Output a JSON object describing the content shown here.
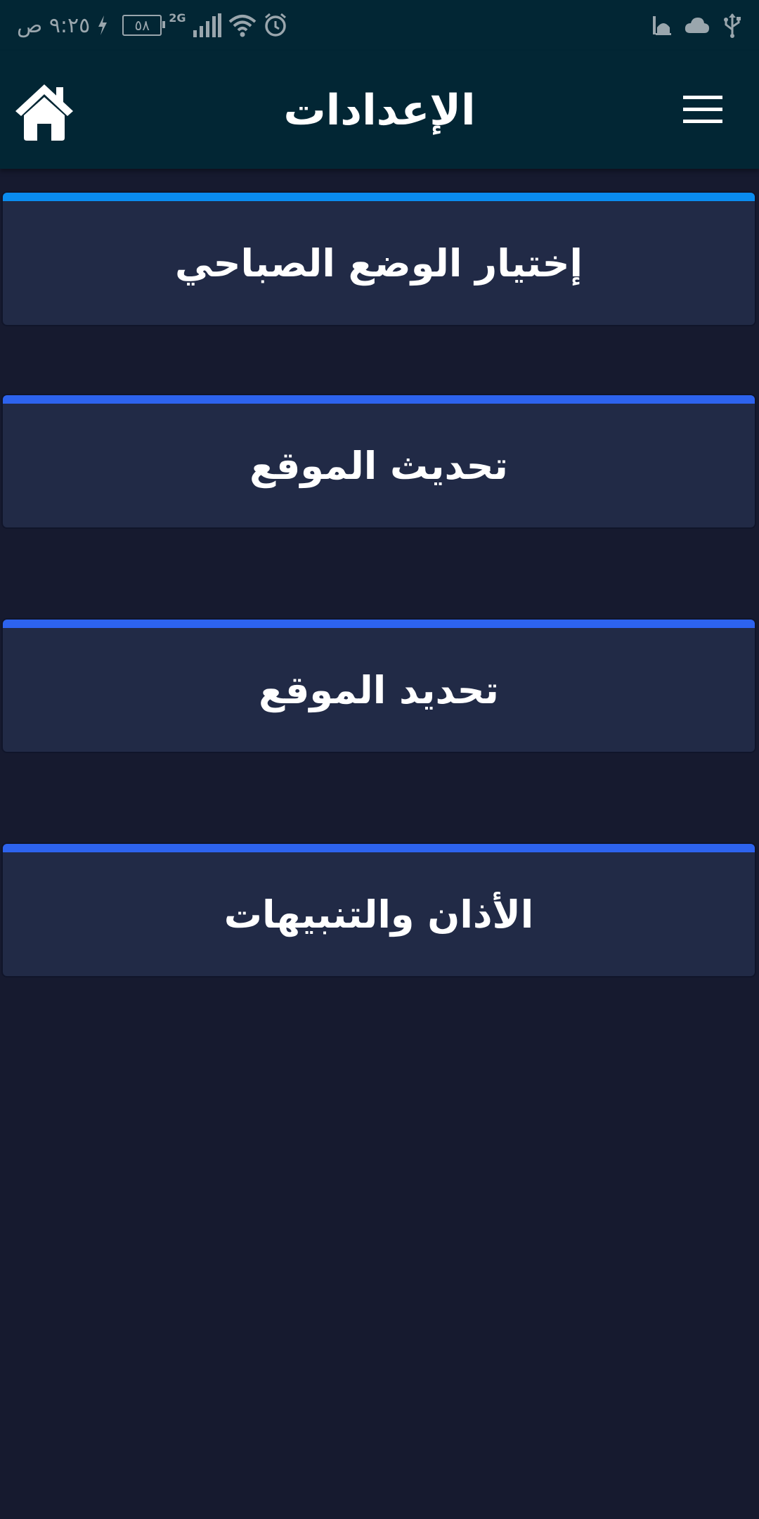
{
  "status_bar": {
    "time": "٩:٢٥ ص",
    "battery": "٥٨",
    "network": "2G",
    "charging_icon": "bolt-icon",
    "signal_icon": "signal-icon",
    "wifi_icon": "wifi-icon",
    "alarm_icon": "alarm-icon",
    "mosque_icon": "mosque-icon",
    "cloud_icon": "cloud-icon",
    "usb_icon": "usb-icon"
  },
  "header": {
    "title": "الإعدادات",
    "home_icon": "home-icon",
    "menu_icon": "menu-icon"
  },
  "settings": {
    "items": [
      {
        "label": "إختيار الوضع الصباحي",
        "accent": "#0a8cf0"
      },
      {
        "label": "تحديث الموقع",
        "accent": "#2d63ee"
      },
      {
        "label": "تحديد الموقع",
        "accent": "#2d63ee"
      },
      {
        "label": "الأذان والتنبيهات",
        "accent": "#2d63ee"
      }
    ]
  },
  "colors": {
    "header_bg": "#022634",
    "page_bg": "#161a2f",
    "card_bg": "#212a46"
  }
}
